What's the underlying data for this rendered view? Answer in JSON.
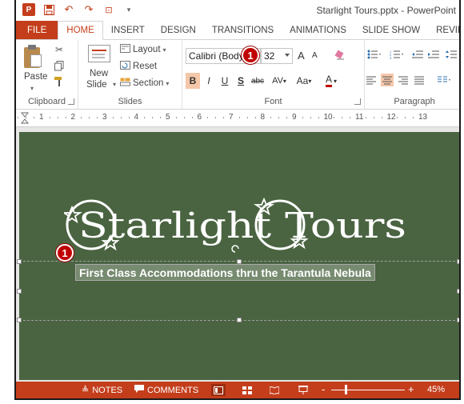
{
  "window": {
    "title": "Starlight Tours.pptx - PowerPoint",
    "app_logo": "P"
  },
  "qat": {
    "save_icon": "save-icon",
    "undo_icon": "undo-icon",
    "redo_icon": "redo-icon",
    "start_icon": "start-from-beginning-icon"
  },
  "tabs": [
    {
      "label": "FILE"
    },
    {
      "label": "HOME"
    },
    {
      "label": "INSERT"
    },
    {
      "label": "DESIGN"
    },
    {
      "label": "TRANSITIONS"
    },
    {
      "label": "ANIMATIONS"
    },
    {
      "label": "SLIDE SHOW"
    },
    {
      "label": "REVIE"
    }
  ],
  "ribbon": {
    "clipboard": {
      "label": "Clipboard",
      "paste_label": "Paste"
    },
    "slides": {
      "label": "Slides",
      "new_slide_line1": "New",
      "new_slide_line2": "Slide",
      "layout_label": "Layout",
      "reset_label": "Reset",
      "section_label": "Section"
    },
    "font": {
      "label": "Font",
      "font_name": "Calibri (Body)",
      "font_size": "32",
      "bold": "B",
      "italic": "I",
      "underline": "U",
      "shadow": "S",
      "strike": "abc",
      "spacing": "AV",
      "case": "Aa",
      "color": "A",
      "grow": "A",
      "shrink": "A"
    },
    "paragraph": {
      "label": "Paragraph"
    }
  },
  "callouts": {
    "font_size_badge": "1",
    "slide_badge": "1"
  },
  "ruler": {
    "labels": [
      "1",
      "2",
      "3",
      "4",
      "5",
      "6",
      "7",
      "8",
      "9",
      "10",
      "11",
      "12",
      "13"
    ]
  },
  "slide": {
    "title": "Starlight Tours",
    "subtitle": "First Class Accommodations thru the Tarantula Nebula",
    "background": "#4a6441"
  },
  "statusbar": {
    "notes_label": "NOTES",
    "comments_label": "COMMENTS",
    "zoom_minus": "-",
    "zoom_plus": "+",
    "zoom_level": "45%",
    "zoom_fraction": 0.45
  },
  "colors": {
    "accent": "#c43e1c",
    "badge": "#c00000"
  }
}
